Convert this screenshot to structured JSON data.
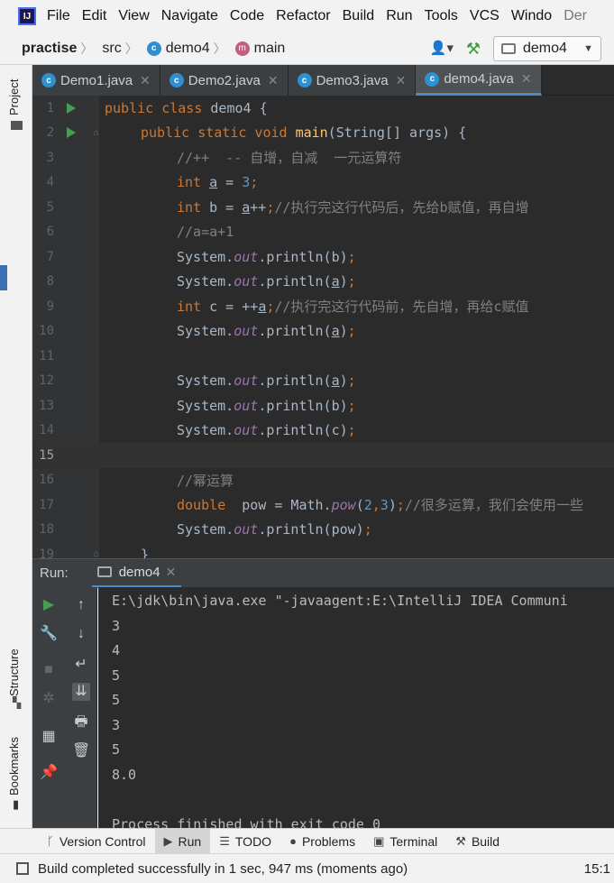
{
  "menubar": {
    "items": [
      "File",
      "Edit",
      "View",
      "Navigate",
      "Code",
      "Refactor",
      "Build",
      "Run",
      "Tools",
      "VCS",
      "Windo"
    ],
    "trailing": "Der"
  },
  "navbar": {
    "project": "practise",
    "folder": "src",
    "class": "demo4",
    "method": "main",
    "run_config": "demo4"
  },
  "left_strip": {
    "project_label": "Project",
    "structure_label": "Structure",
    "bookmarks_label": "Bookmarks"
  },
  "tabs": [
    {
      "label": "Demo1.java"
    },
    {
      "label": "Demo2.java"
    },
    {
      "label": "Demo3.java"
    },
    {
      "label": "demo4.java"
    }
  ],
  "editor": {
    "line_numbers": [
      "1",
      "2",
      "3",
      "4",
      "5",
      "6",
      "7",
      "8",
      "9",
      "10",
      "11",
      "12",
      "13",
      "14",
      "15",
      "16",
      "17",
      "18",
      "19"
    ],
    "current_line": "15"
  },
  "run_panel": {
    "label": "Run:",
    "tab": "demo4",
    "console": [
      "E:\\jdk\\bin\\java.exe \"-javaagent:E:\\IntelliJ IDEA Communi",
      "3",
      "4",
      "5",
      "5",
      "3",
      "5",
      "8.0",
      "",
      "Process finished with exit code 0"
    ]
  },
  "tool_windows": [
    {
      "label": "Version Control",
      "icon": "branch-icon"
    },
    {
      "label": "Run",
      "icon": "play-icon"
    },
    {
      "label": "TODO",
      "icon": "list-icon"
    },
    {
      "label": "Problems",
      "icon": "warning-icon"
    },
    {
      "label": "Terminal",
      "icon": "terminal-icon"
    },
    {
      "label": "Build",
      "icon": "hammer-icon"
    }
  ],
  "status": {
    "message": "Build completed successfully in 1 sec, 947 ms (moments ago)",
    "position": "15:1"
  },
  "colors": {
    "keyword": "#cc7832",
    "function": "#ffc66d",
    "number": "#6897bb",
    "comment": "#808080",
    "static_field": "#9876aa",
    "run_green": "#499c54",
    "accent": "#4a88c7"
  }
}
